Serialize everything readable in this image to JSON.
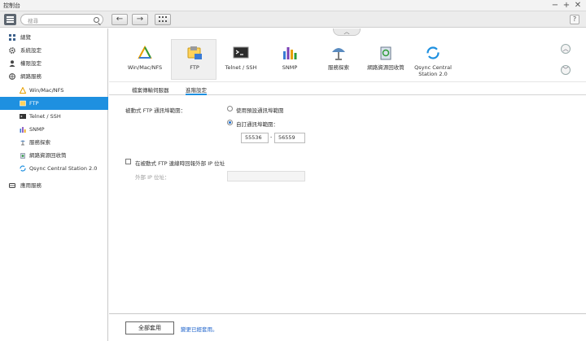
{
  "window": {
    "title": "控制台",
    "minimize": "−",
    "maximize": "+",
    "close": "✕"
  },
  "toolbar": {
    "search_placeholder": "搜尋",
    "back": "←",
    "forward": "→",
    "help": "?"
  },
  "sidebar": {
    "items": [
      {
        "label": "總覽",
        "type": "cat",
        "icon": "overview-icon"
      },
      {
        "label": "系統設定",
        "type": "cat",
        "icon": "gear-icon"
      },
      {
        "label": "權限設定",
        "type": "cat",
        "icon": "user-icon"
      },
      {
        "label": "網路服務",
        "type": "cat",
        "icon": "network-icon"
      },
      {
        "label": "Win/Mac/NFS",
        "type": "sub",
        "icon": "win-mac-nfs-icon"
      },
      {
        "label": "FTP",
        "type": "sub",
        "icon": "ftp-icon",
        "selected": true
      },
      {
        "label": "Telnet / SSH",
        "type": "sub",
        "icon": "terminal-icon"
      },
      {
        "label": "SNMP",
        "type": "sub",
        "icon": "snmp-icon"
      },
      {
        "label": "服務探索",
        "type": "sub",
        "icon": "service-discovery-icon"
      },
      {
        "label": "網路資源回收筒",
        "type": "sub",
        "icon": "recycle-bin-icon"
      },
      {
        "label": "Qsync Central Station 2.0",
        "type": "sub",
        "icon": "qsync-icon"
      },
      {
        "label": "應用服務",
        "type": "cat",
        "icon": "applications-icon"
      }
    ]
  },
  "apps": [
    {
      "label": "Win/Mac/NFS",
      "icon": "win-mac-nfs-icon"
    },
    {
      "label": "FTP",
      "icon": "ftp-icon",
      "selected": true
    },
    {
      "label": "Telnet / SSH",
      "icon": "terminal-icon"
    },
    {
      "label": "SNMP",
      "icon": "snmp-icon"
    },
    {
      "label": "服務探索",
      "icon": "service-discovery-icon"
    },
    {
      "label": "網路資源回收筒",
      "icon": "recycle-bin-icon"
    },
    {
      "label": "Qsync Central\nStation 2.0",
      "icon": "qsync-icon"
    }
  ],
  "tabs": [
    {
      "label": "檔案傳輸伺服器"
    },
    {
      "label": "進階設定",
      "active": true
    }
  ],
  "form": {
    "passive_ports_label": "被動式 FTP 通訊埠範圍：",
    "option_default": "使用預設通訊埠範圍",
    "option_custom": "自訂通訊埠範圍：",
    "port_from": "55536",
    "port_separator": "-",
    "port_to": "56559",
    "external_ip_checkbox": "在被動式 FTP 連線時回報外部 IP 位址",
    "external_ip_label": "外部 IP 位址：",
    "external_ip_value": ""
  },
  "footer": {
    "apply_all": "全部套用",
    "changes_note": "變更已經套用。"
  },
  "colors": {
    "accent": "#1e90e0",
    "selected_text": "#ffffff",
    "link": "#2266cc"
  }
}
